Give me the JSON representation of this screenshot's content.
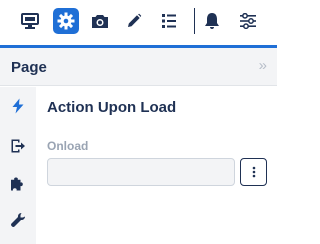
{
  "toolbar": {
    "buttons": [
      {
        "icon": "desktop-preview-icon",
        "active": false
      },
      {
        "icon": "gear-icon",
        "active": true
      },
      {
        "icon": "camera-icon",
        "active": false
      },
      {
        "icon": "pencil-icon",
        "active": false
      },
      {
        "icon": "list-icon",
        "active": false
      },
      {
        "icon": "bell-icon",
        "active": false
      },
      {
        "icon": "sliders-icon",
        "active": false
      }
    ],
    "accent_color": "#1f6fd6"
  },
  "panel": {
    "title": "Page",
    "collapse_glyph": "»"
  },
  "rail": {
    "items": [
      {
        "icon": "lightning-icon",
        "active": true
      },
      {
        "icon": "exit-icon",
        "active": false
      },
      {
        "icon": "puzzle-icon",
        "active": false
      },
      {
        "icon": "wrench-icon",
        "active": false
      }
    ]
  },
  "content": {
    "section_title": "Action Upon Load",
    "field": {
      "label": "Onload",
      "value": "",
      "placeholder": ""
    }
  }
}
